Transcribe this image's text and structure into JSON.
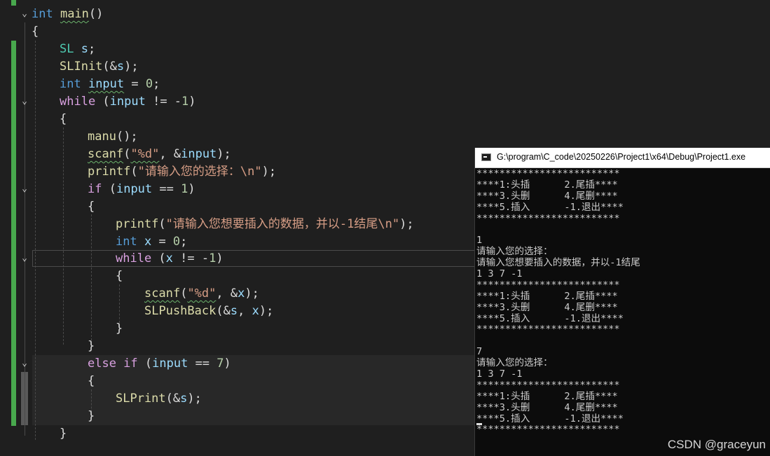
{
  "editor": {
    "lines": [
      [
        "int ",
        "main",
        "()"
      ],
      [
        "{"
      ],
      [
        "SL",
        " ",
        "s",
        ";"
      ],
      [
        "SLInit",
        "(&",
        "s",
        ");"
      ],
      [
        "int ",
        "input",
        " = ",
        "0",
        ";"
      ],
      [
        "while",
        " (",
        "input",
        " != -",
        "1",
        ")"
      ],
      [
        "{"
      ],
      [
        "manu",
        "();"
      ],
      [
        "scanf",
        "(",
        "\"%d\"",
        ", &",
        "input",
        ");"
      ],
      [
        "printf",
        "(",
        "\"请输入您的选择：\\n\"",
        ");"
      ],
      [
        "if",
        " (",
        "input",
        " == ",
        "1",
        ")"
      ],
      [
        "{"
      ],
      [
        "printf",
        "(",
        "\"请输入您想要插入的数据，并以-1结尾\\n\"",
        ");"
      ],
      [
        "int ",
        "x",
        " = ",
        "0",
        ";"
      ],
      [
        "while",
        " (",
        "x",
        " != -",
        "1",
        ")"
      ],
      [
        "{"
      ],
      [
        "scanf",
        "(",
        "\"%d\"",
        ", &",
        "x",
        ");"
      ],
      [
        "SLPushBack",
        "(&",
        "s",
        ", ",
        "x",
        ");"
      ],
      [
        "}"
      ],
      [
        "}"
      ],
      [
        "else if",
        " (",
        "input",
        " == ",
        "7",
        ")"
      ],
      [
        "{"
      ],
      [
        "SLPrint",
        "(&",
        "s",
        ");"
      ],
      [
        "}"
      ],
      [
        "}"
      ]
    ]
  },
  "console": {
    "title": "G:\\program\\C_code\\20250226\\Project1\\x64\\Debug\\Project1.exe",
    "lines": [
      "*************************",
      "****1:头插      2.尾插****",
      "****3.头删      4.尾删****",
      "****5.插入      -1.退出****",
      "*************************",
      "",
      "1",
      "请输入您的选择：",
      "请输入您想要插入的数据，并以-1结尾",
      "1 3 7 -1",
      "*************************",
      "****1:头插      2.尾插****",
      "****3.头删      4.尾删****",
      "****5.插入      -1.退出****",
      "*************************",
      "",
      "7",
      "请输入您的选择：",
      "1 3 7 -1",
      "*************************",
      "****1:头插      2.尾插****",
      "****3.头删      4.尾删****",
      "****5.插入      -1.退出****",
      "*************************"
    ]
  },
  "watermark": "CSDN @graceyun"
}
